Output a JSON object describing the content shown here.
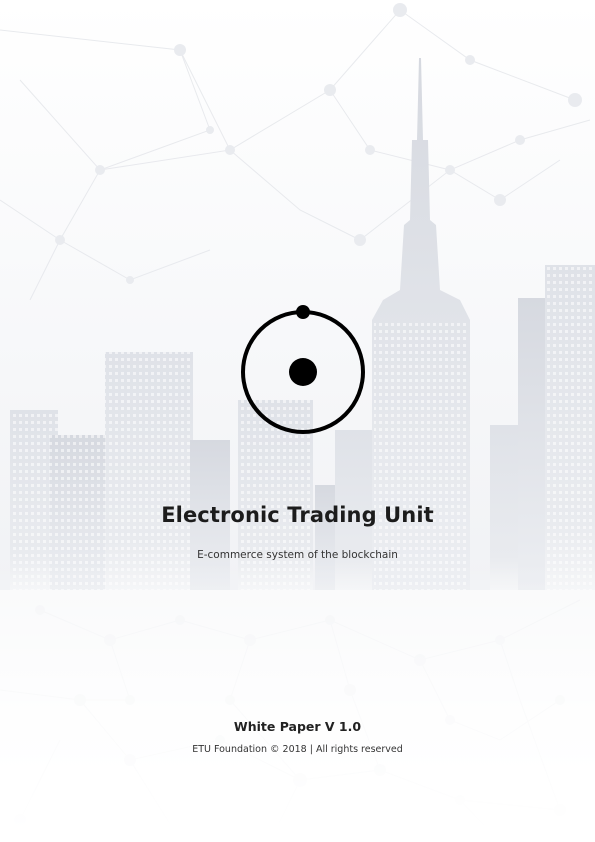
{
  "cover": {
    "title": "Electronic Trading Unit",
    "subtitle": "E-commerce system of the blockchain",
    "version": "White Paper V 1.0",
    "copyright": "ETU Foundation © 2018 | All rights reserved"
  },
  "colors": {
    "text_primary": "#1c1c1c",
    "logo": "#000000",
    "background": "#ffffff"
  },
  "icons": {
    "logo": "orbit-circle-logo-icon",
    "background": "city-skyline-network-illustration"
  }
}
